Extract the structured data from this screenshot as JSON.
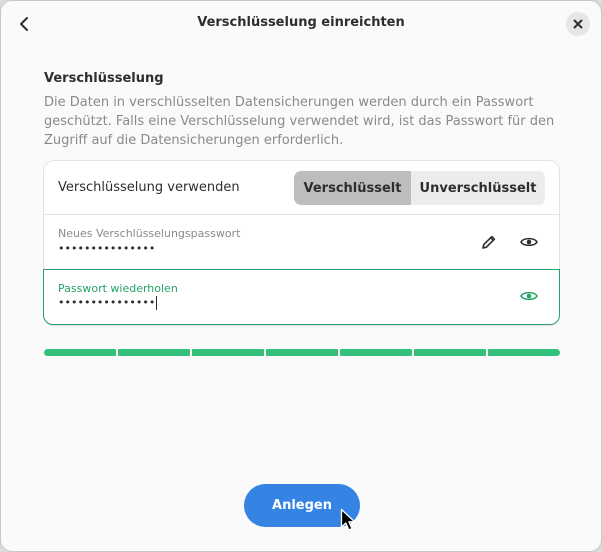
{
  "header": {
    "title": "Verschlüsselung einreichten",
    "back_icon": "chevron-left-icon",
    "close_icon": "close-icon"
  },
  "section": {
    "title": "Verschlüsselung",
    "description": "Die Daten in verschlüsselten Datensicherungen werden durch ein Passwort geschützt. Falls eine Verschlüsselung verwendet wird, ist das Passwort für den Zugriff auf die Datensicherungen erforderlich."
  },
  "encryption": {
    "label": "Verschlüsselung verwenden",
    "options": [
      "Verschlüsselt",
      "Unverschlüsselt"
    ],
    "selected": "Verschlüsselt"
  },
  "new_password": {
    "label": "Neues Verschlüsselungspasswort",
    "value": "•••••••••••••••",
    "edit_icon": "pencil-icon",
    "reveal_icon": "eye-icon"
  },
  "repeat_password": {
    "label": "Passwort wiederholen",
    "value": "•••••••••••••••",
    "reveal_icon": "eye-icon"
  },
  "strength": {
    "segments_filled": 7,
    "segments_total": 7,
    "color": "#33c07a"
  },
  "actions": {
    "create_label": "Anlegen"
  },
  "colors": {
    "accent": "#3584e4",
    "success": "#26a269"
  }
}
